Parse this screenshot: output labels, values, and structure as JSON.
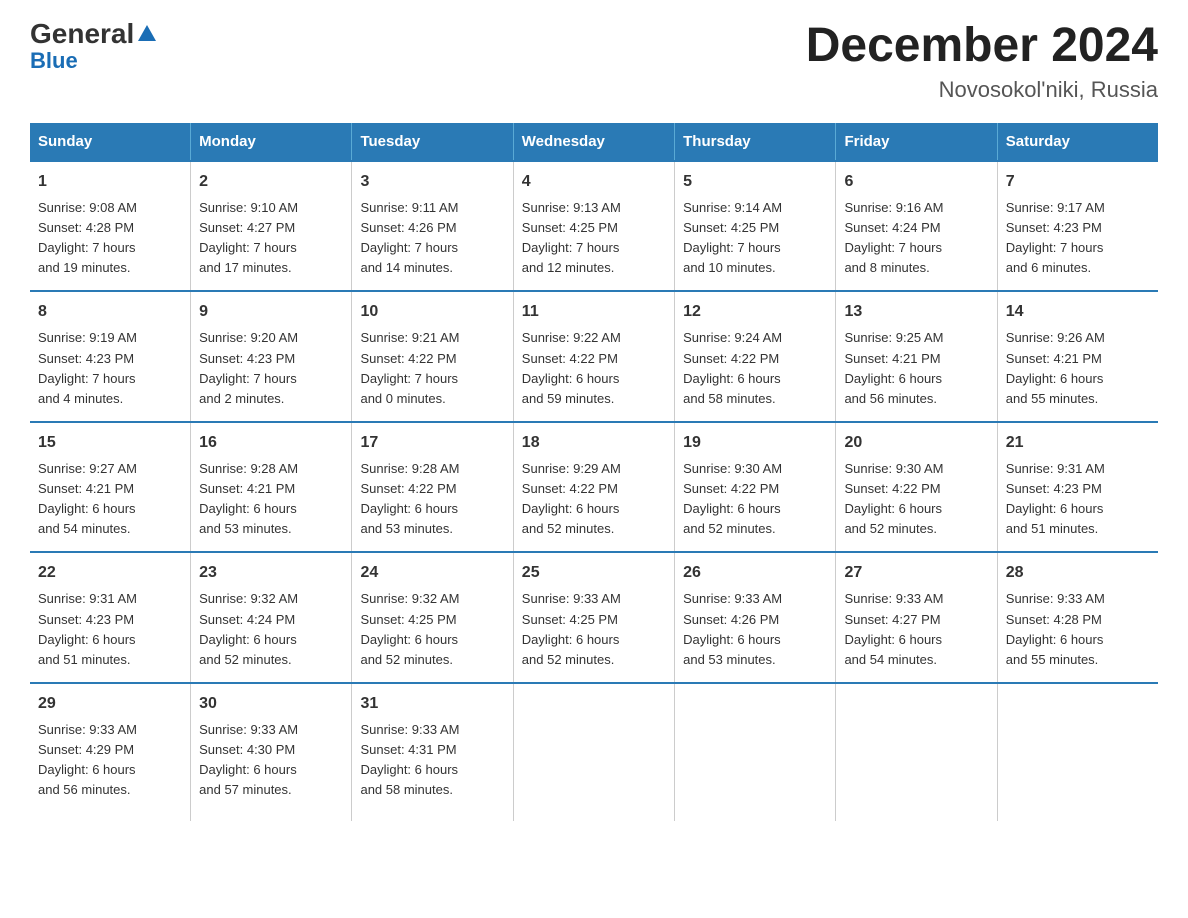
{
  "logo": {
    "general": "General",
    "blue": "Blue"
  },
  "title": "December 2024",
  "subtitle": "Novosokol'niki, Russia",
  "days_header": [
    "Sunday",
    "Monday",
    "Tuesday",
    "Wednesday",
    "Thursday",
    "Friday",
    "Saturday"
  ],
  "weeks": [
    [
      {
        "day": "1",
        "info": "Sunrise: 9:08 AM\nSunset: 4:28 PM\nDaylight: 7 hours\nand 19 minutes."
      },
      {
        "day": "2",
        "info": "Sunrise: 9:10 AM\nSunset: 4:27 PM\nDaylight: 7 hours\nand 17 minutes."
      },
      {
        "day": "3",
        "info": "Sunrise: 9:11 AM\nSunset: 4:26 PM\nDaylight: 7 hours\nand 14 minutes."
      },
      {
        "day": "4",
        "info": "Sunrise: 9:13 AM\nSunset: 4:25 PM\nDaylight: 7 hours\nand 12 minutes."
      },
      {
        "day": "5",
        "info": "Sunrise: 9:14 AM\nSunset: 4:25 PM\nDaylight: 7 hours\nand 10 minutes."
      },
      {
        "day": "6",
        "info": "Sunrise: 9:16 AM\nSunset: 4:24 PM\nDaylight: 7 hours\nand 8 minutes."
      },
      {
        "day": "7",
        "info": "Sunrise: 9:17 AM\nSunset: 4:23 PM\nDaylight: 7 hours\nand 6 minutes."
      }
    ],
    [
      {
        "day": "8",
        "info": "Sunrise: 9:19 AM\nSunset: 4:23 PM\nDaylight: 7 hours\nand 4 minutes."
      },
      {
        "day": "9",
        "info": "Sunrise: 9:20 AM\nSunset: 4:23 PM\nDaylight: 7 hours\nand 2 minutes."
      },
      {
        "day": "10",
        "info": "Sunrise: 9:21 AM\nSunset: 4:22 PM\nDaylight: 7 hours\nand 0 minutes."
      },
      {
        "day": "11",
        "info": "Sunrise: 9:22 AM\nSunset: 4:22 PM\nDaylight: 6 hours\nand 59 minutes."
      },
      {
        "day": "12",
        "info": "Sunrise: 9:24 AM\nSunset: 4:22 PM\nDaylight: 6 hours\nand 58 minutes."
      },
      {
        "day": "13",
        "info": "Sunrise: 9:25 AM\nSunset: 4:21 PM\nDaylight: 6 hours\nand 56 minutes."
      },
      {
        "day": "14",
        "info": "Sunrise: 9:26 AM\nSunset: 4:21 PM\nDaylight: 6 hours\nand 55 minutes."
      }
    ],
    [
      {
        "day": "15",
        "info": "Sunrise: 9:27 AM\nSunset: 4:21 PM\nDaylight: 6 hours\nand 54 minutes."
      },
      {
        "day": "16",
        "info": "Sunrise: 9:28 AM\nSunset: 4:21 PM\nDaylight: 6 hours\nand 53 minutes."
      },
      {
        "day": "17",
        "info": "Sunrise: 9:28 AM\nSunset: 4:22 PM\nDaylight: 6 hours\nand 53 minutes."
      },
      {
        "day": "18",
        "info": "Sunrise: 9:29 AM\nSunset: 4:22 PM\nDaylight: 6 hours\nand 52 minutes."
      },
      {
        "day": "19",
        "info": "Sunrise: 9:30 AM\nSunset: 4:22 PM\nDaylight: 6 hours\nand 52 minutes."
      },
      {
        "day": "20",
        "info": "Sunrise: 9:30 AM\nSunset: 4:22 PM\nDaylight: 6 hours\nand 52 minutes."
      },
      {
        "day": "21",
        "info": "Sunrise: 9:31 AM\nSunset: 4:23 PM\nDaylight: 6 hours\nand 51 minutes."
      }
    ],
    [
      {
        "day": "22",
        "info": "Sunrise: 9:31 AM\nSunset: 4:23 PM\nDaylight: 6 hours\nand 51 minutes."
      },
      {
        "day": "23",
        "info": "Sunrise: 9:32 AM\nSunset: 4:24 PM\nDaylight: 6 hours\nand 52 minutes."
      },
      {
        "day": "24",
        "info": "Sunrise: 9:32 AM\nSunset: 4:25 PM\nDaylight: 6 hours\nand 52 minutes."
      },
      {
        "day": "25",
        "info": "Sunrise: 9:33 AM\nSunset: 4:25 PM\nDaylight: 6 hours\nand 52 minutes."
      },
      {
        "day": "26",
        "info": "Sunrise: 9:33 AM\nSunset: 4:26 PM\nDaylight: 6 hours\nand 53 minutes."
      },
      {
        "day": "27",
        "info": "Sunrise: 9:33 AM\nSunset: 4:27 PM\nDaylight: 6 hours\nand 54 minutes."
      },
      {
        "day": "28",
        "info": "Sunrise: 9:33 AM\nSunset: 4:28 PM\nDaylight: 6 hours\nand 55 minutes."
      }
    ],
    [
      {
        "day": "29",
        "info": "Sunrise: 9:33 AM\nSunset: 4:29 PM\nDaylight: 6 hours\nand 56 minutes."
      },
      {
        "day": "30",
        "info": "Sunrise: 9:33 AM\nSunset: 4:30 PM\nDaylight: 6 hours\nand 57 minutes."
      },
      {
        "day": "31",
        "info": "Sunrise: 9:33 AM\nSunset: 4:31 PM\nDaylight: 6 hours\nand 58 minutes."
      },
      {
        "day": "",
        "info": ""
      },
      {
        "day": "",
        "info": ""
      },
      {
        "day": "",
        "info": ""
      },
      {
        "day": "",
        "info": ""
      }
    ]
  ]
}
